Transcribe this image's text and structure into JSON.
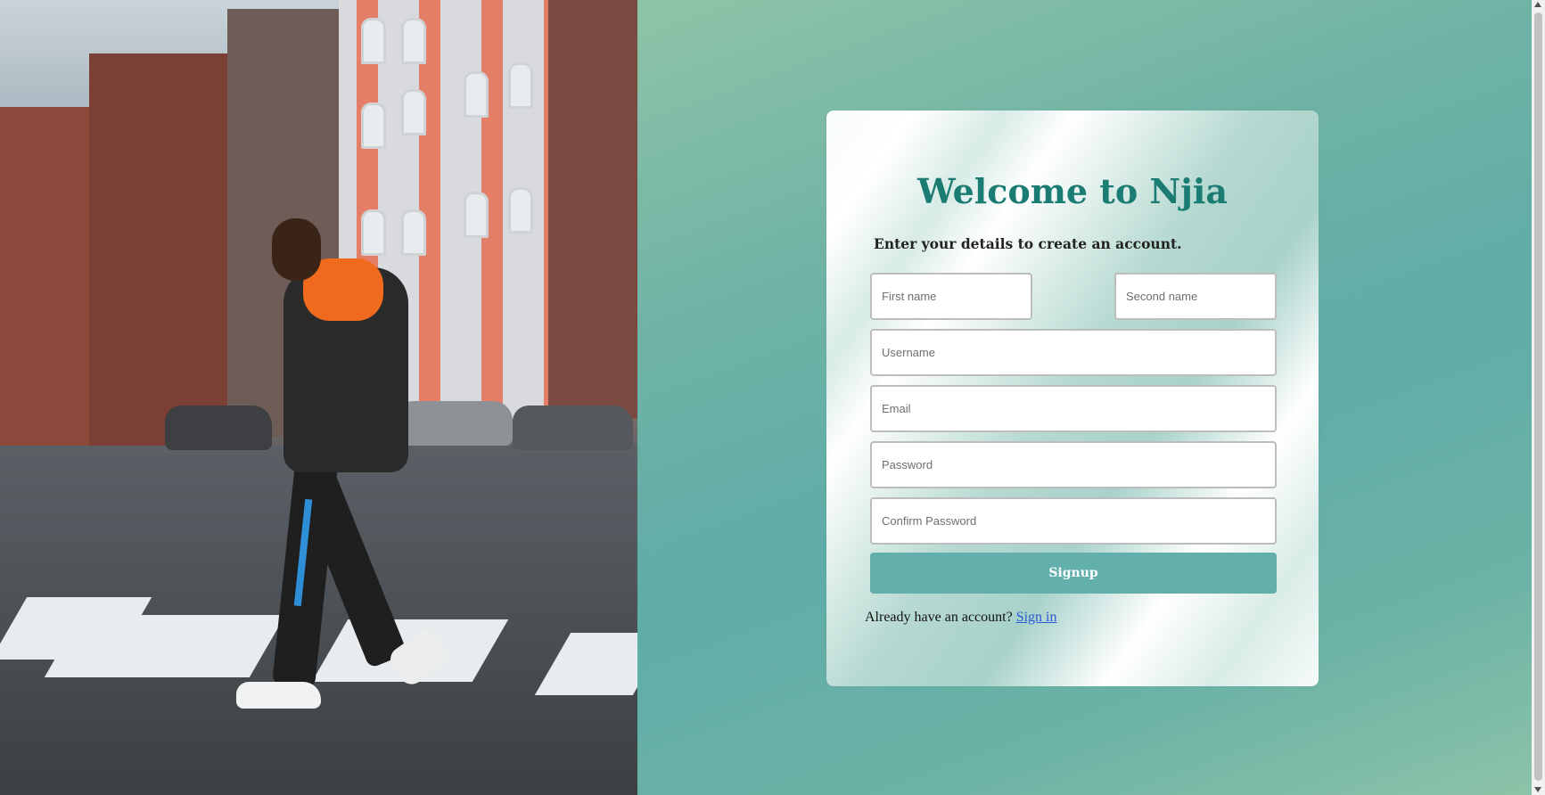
{
  "hero_image": {
    "alt": ""
  },
  "signup": {
    "title": "Welcome to Njia",
    "subtitle": "Enter your details to create an account.",
    "first_name_placeholder": "First name",
    "second_name_placeholder": "Second name",
    "username_placeholder": "Username",
    "email_placeholder": "Email",
    "password_placeholder": "Password",
    "confirm_password_placeholder": "Confirm Password",
    "signup_label": "Signup",
    "signin_prompt": "Already have an account?",
    "signin_link": "Sign in"
  },
  "colors": {
    "brand": "#1a7c72",
    "button": "#63afac",
    "link": "#2a59d6"
  }
}
